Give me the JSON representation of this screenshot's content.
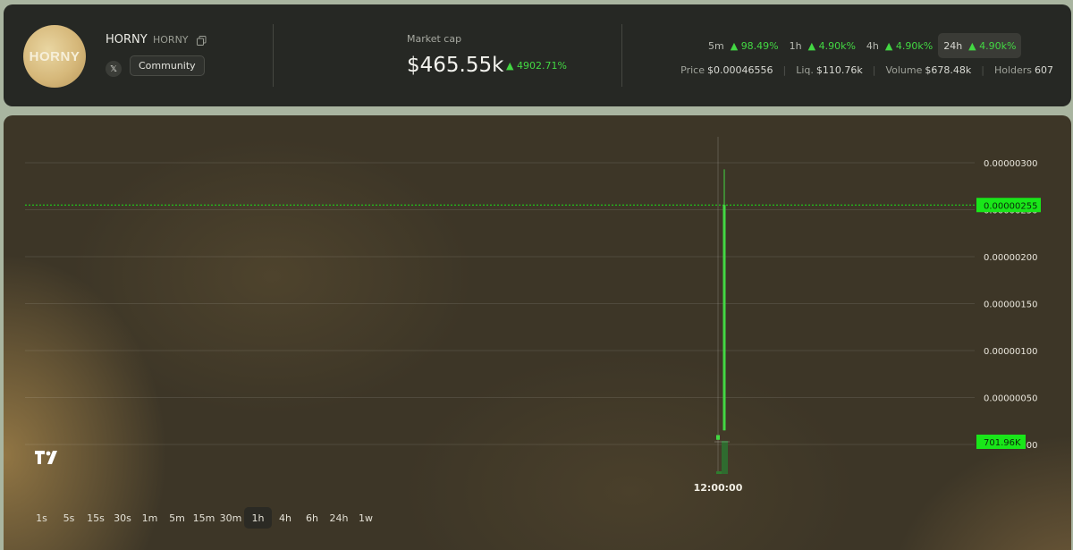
{
  "token": {
    "avatar_text": "HORNY",
    "name": "HORNY",
    "symbol": "HORNY",
    "community_label": "Community"
  },
  "market_cap": {
    "label": "Market cap",
    "value": "$465.55k",
    "change": "4902.71%"
  },
  "timeframes": [
    {
      "label": "5m",
      "change": "98.49%"
    },
    {
      "label": "1h",
      "change": "4.90k%"
    },
    {
      "label": "4h",
      "change": "4.90k%"
    },
    {
      "label": "24h",
      "change": "4.90k%",
      "active": true
    }
  ],
  "stats": {
    "price_label": "Price",
    "price": "$0.00046556",
    "liq_label": "Liq.",
    "liq": "$110.76k",
    "volume_label": "Volume",
    "volume": "$678.48k",
    "holders_label": "Holders",
    "holders": "607"
  },
  "intervals": [
    "1s",
    "5s",
    "15s",
    "30s",
    "1m",
    "5m",
    "15m",
    "30m",
    "1h",
    "4h",
    "6h",
    "24h",
    "1w"
  ],
  "active_interval": "1h",
  "colors": {
    "up": "#43d843",
    "label_bg": "#19e619",
    "panel": "#262824"
  },
  "chart_data": {
    "type": "candlestick",
    "y_ticks": [
      "0.00000300",
      "0.00000250",
      "0.00000200",
      "0.00000150",
      "0.00000100",
      "0.00000050",
      "0.00000000"
    ],
    "y_tick_values": [
      3e-06,
      2.5e-06,
      2e-06,
      1.5e-06,
      1e-06,
      5e-07,
      0
    ],
    "ylim": [
      0,
      3e-06
    ],
    "x_ticks": [
      "12:00:00"
    ],
    "current_price_label": "0.00000255",
    "current_price_value": 2.55e-06,
    "volume_label": "701.96K",
    "candles": [
      {
        "open": 1e-07,
        "close": 5e-08,
        "high": 1e-07,
        "low": 5e-08
      },
      {
        "open": 1.5e-07,
        "close": 2.55e-06,
        "high": 2.93e-06,
        "low": 1.5e-07
      }
    ]
  }
}
